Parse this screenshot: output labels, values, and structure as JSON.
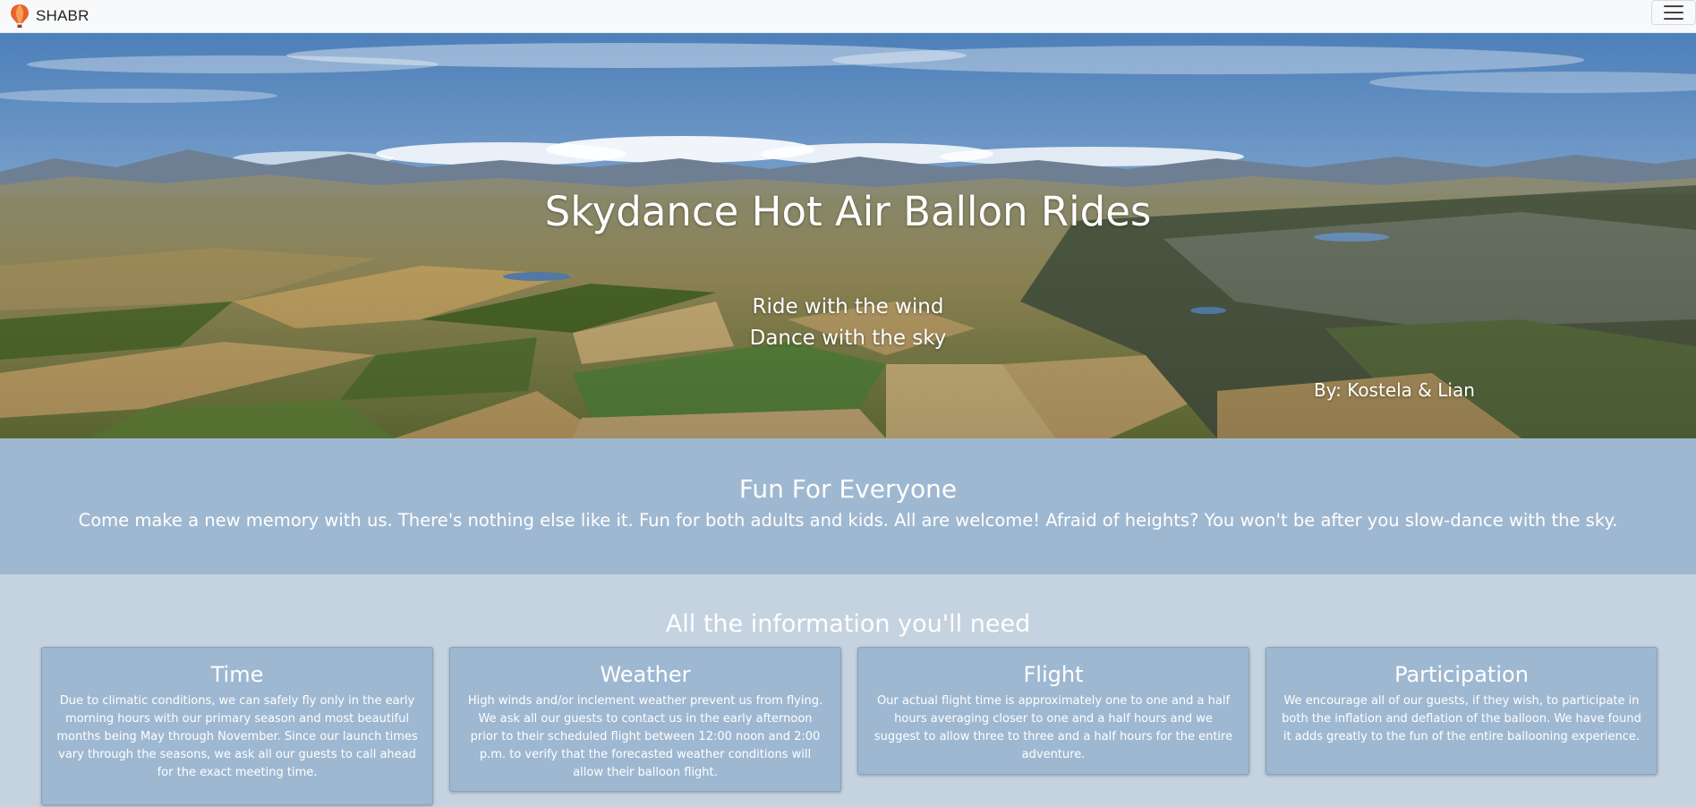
{
  "navbar": {
    "brand": "SHABR",
    "logo_icon": "hot-air-balloon-icon",
    "menu_icon": "hamburger-menu-icon"
  },
  "hero": {
    "title": "Skydance Hot Air Ballon Rides",
    "tagline_1": "Ride with the wind",
    "tagline_2": "Dance with the sky",
    "credit": "By: Kostela & Lian"
  },
  "fun": {
    "title": "Fun For Everyone",
    "text": "Come make a new memory with us. There's nothing else like it. Fun for both adults and kids. All are welcome! Afraid of heights? You won't be after you slow-dance with the sky."
  },
  "info": {
    "title": "All the information you'll need",
    "cards": [
      {
        "title": "Time",
        "text": "Due to climatic conditions, we can safely fly only in the early morning hours with our primary season and most beautiful months being May through November. Since our launch times vary through the seasons, we ask all our guests to call ahead for the exact meeting time."
      },
      {
        "title": "Weather",
        "text": "High winds and/or inclement weather prevent us from flying. We ask all our guests to contact us in the early afternoon prior to their scheduled flight between 12:00 noon and 2:00 p.m. to verify that the forecasted weather conditions will allow their balloon flight."
      },
      {
        "title": "Flight",
        "text": "Our actual flight time is approximately one to one and a half hours averaging closer to one and a half hours and we suggest to allow three to three and a half hours for the entire adventure."
      },
      {
        "title": "Participation",
        "text": "We encourage all of our guests, if they wish, to participate in both the inflation and deflation of the balloon. We have found it adds greatly to the fun of the entire ballooning experience."
      }
    ]
  },
  "colors": {
    "navbar_bg": "#f8f9fa",
    "fun_bg": "#9fb8d1",
    "info_bg": "#c5d2df",
    "card_bg": "#9fb8d1",
    "text": "#ffffff"
  }
}
